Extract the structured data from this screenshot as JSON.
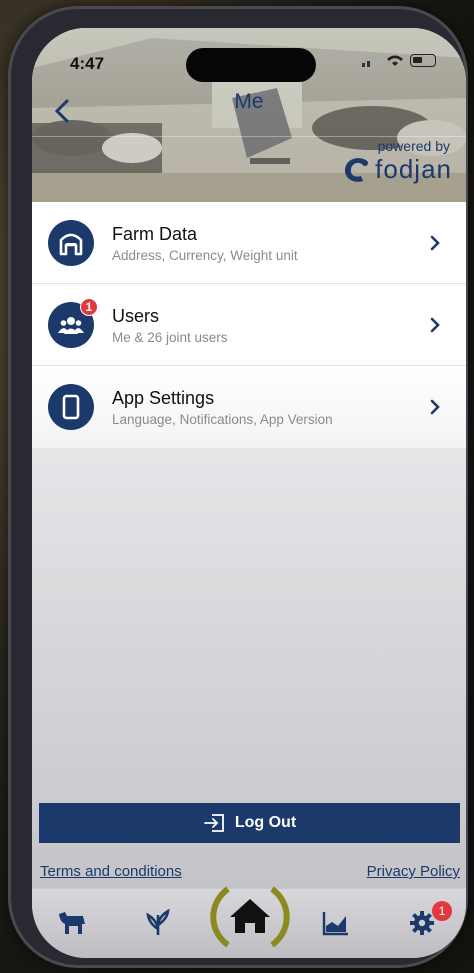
{
  "status": {
    "time": "4:47"
  },
  "header": {
    "title": "Me",
    "powered_by": "powered by",
    "brand": "fodjan"
  },
  "menu": [
    {
      "title": "Farm Data",
      "subtitle": "Address, Currency, Weight unit",
      "icon": "barn-icon"
    },
    {
      "title": "Users",
      "subtitle": "Me & 26 joint users",
      "icon": "users-icon",
      "badge": "1"
    },
    {
      "title": "App Settings",
      "subtitle": "Language, Notifications, App Version",
      "icon": "phone-icon"
    }
  ],
  "logout_label": "Log Out",
  "links": {
    "terms": "Terms and conditions",
    "privacy": "Privacy Policy"
  },
  "tabbar": {
    "items": [
      "cow-icon",
      "crop-icon",
      "home-icon",
      "chart-icon",
      "settings-icon"
    ],
    "settings_badge": "1"
  },
  "colors": {
    "primary": "#1b3a6b",
    "badge": "#e03a3e",
    "home_ring": "#8a8a1f"
  }
}
